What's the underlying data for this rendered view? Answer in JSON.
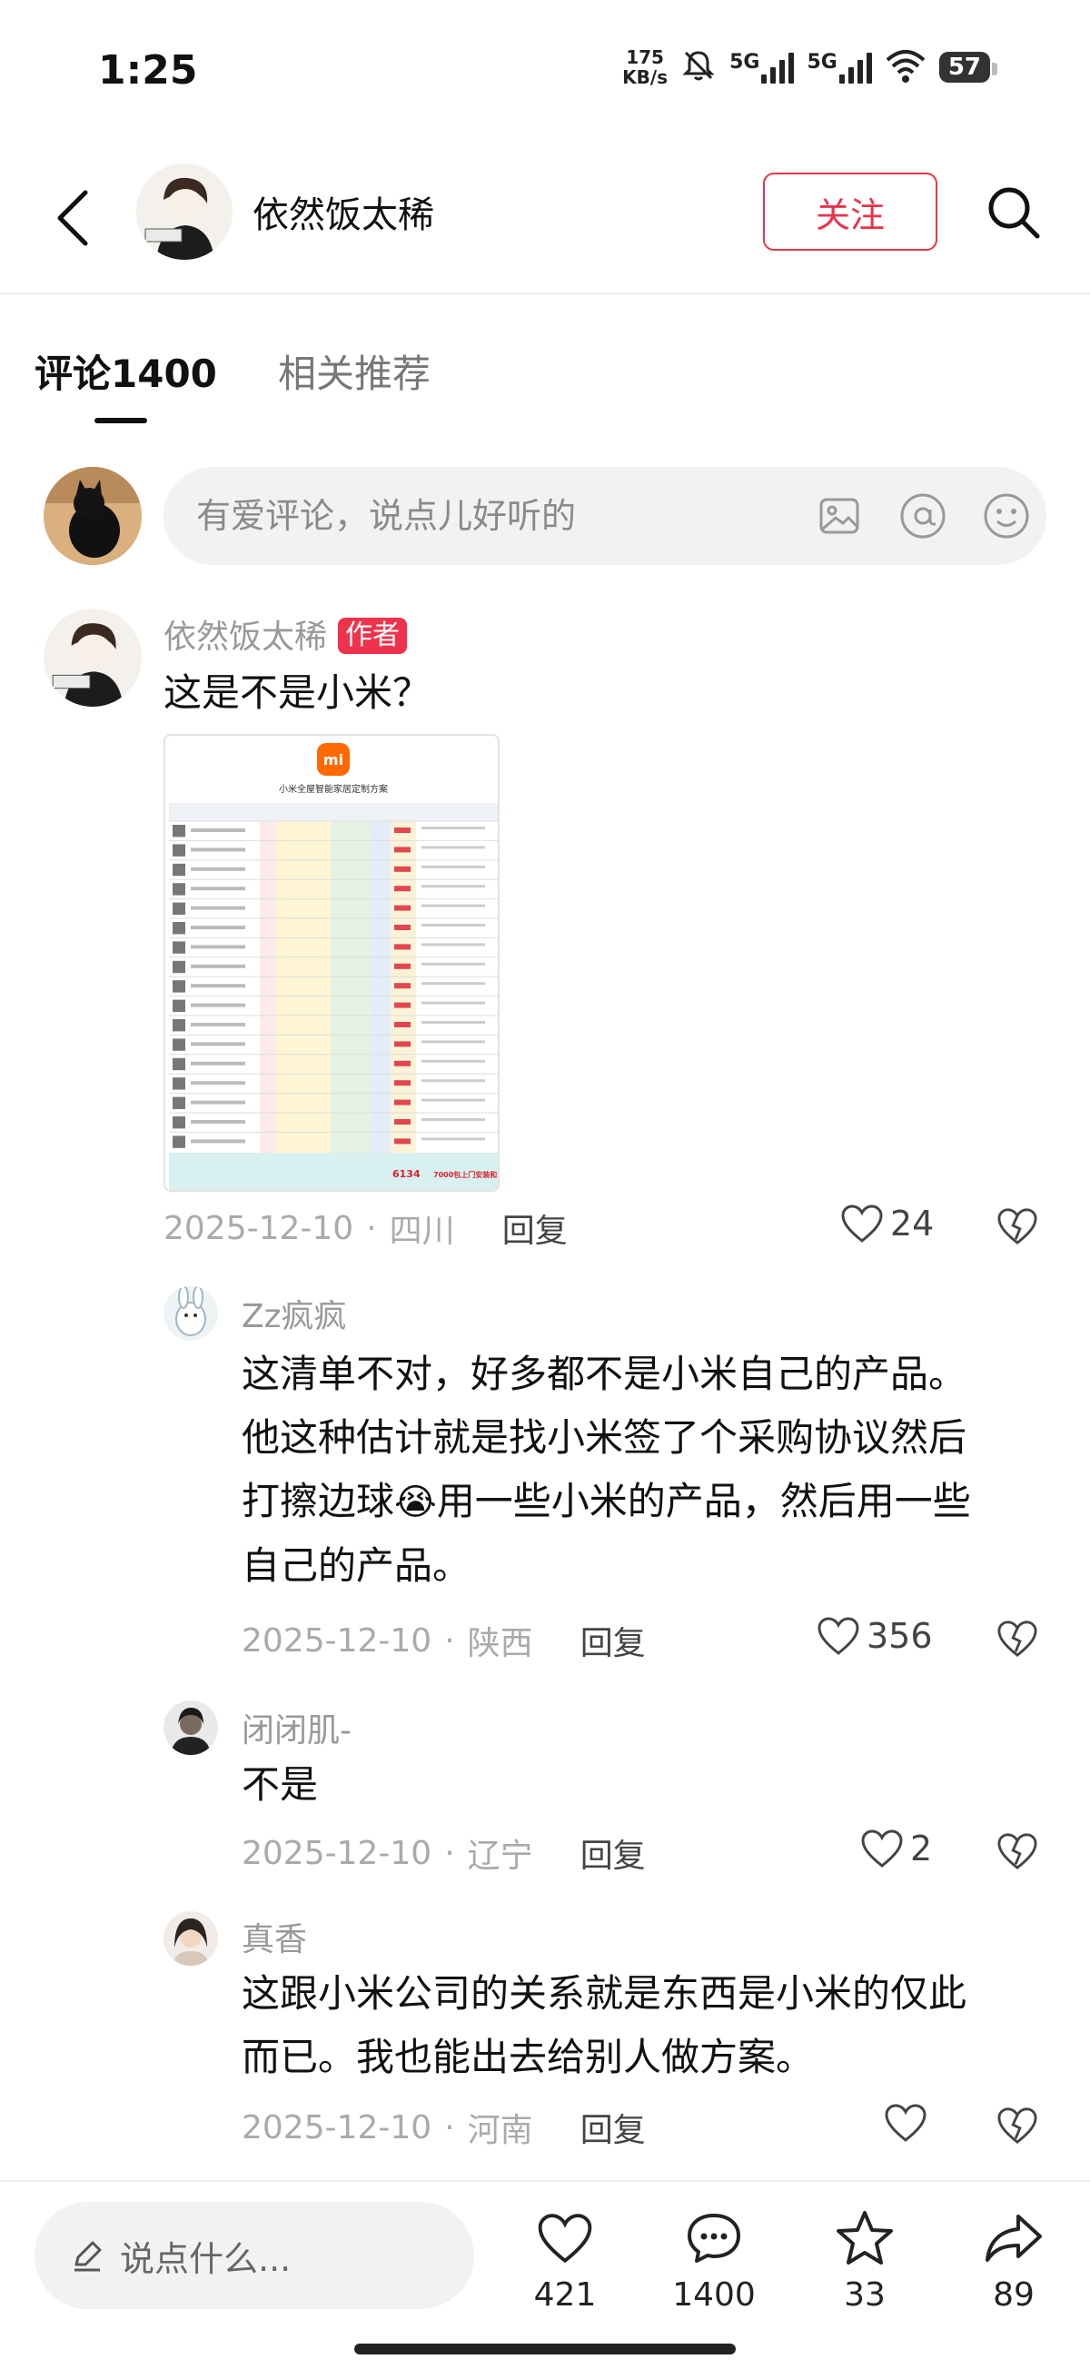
{
  "status_bar": {
    "time": "1:25",
    "net_speed_value": "175",
    "net_speed_unit": "KB/s",
    "signal1": "5G",
    "signal2": "5G",
    "battery": "57"
  },
  "header": {
    "user_name": "依然饭太稀",
    "follow_label": "关注"
  },
  "tabs": {
    "comments": "评论1400",
    "related": "相关推荐"
  },
  "comment_input": {
    "placeholder": "有爱评论，说点儿好听的"
  },
  "comments": [
    {
      "name": "依然饭太稀",
      "badge": "作者",
      "text": "这是不是小米？",
      "image": {
        "title": "小米全屋智能家居定制方案",
        "total": "6134",
        "footer": "7000包上门安装和"
      },
      "date": "2025-12-10",
      "region": "四川",
      "reply": "回复",
      "likes": "24"
    },
    {
      "name": "Zz疯疯",
      "text_lines": [
        "这清单不对，好多都不是小米自己的产品。",
        "他这种估计就是找小米签了个采购协议然后",
        "打擦边球",
        "用一些小米的产品，然后用一些",
        "自己的产品。"
      ],
      "emoji": "😭",
      "date": "2025-12-10",
      "region": "陕西",
      "reply": "回复",
      "likes": "356"
    },
    {
      "name": "闭闭肌-",
      "text": "不是",
      "date": "2025-12-10",
      "region": "辽宁",
      "reply": "回复",
      "likes": "2"
    },
    {
      "name": "真香",
      "text_lines": [
        "这跟小米公司的关系就是东西是小米的仅此",
        "而已。我也能出去给别人做方案。"
      ],
      "date": "2025-12-10",
      "region": "河南",
      "reply": "回复",
      "likes": ""
    }
  ],
  "bottom_bar": {
    "say_placeholder": "说点什么...",
    "likes": "421",
    "comments": "1400",
    "favorites": "33",
    "shares": "89"
  },
  "colors": {
    "accent": "#e8334a",
    "badge": "#f0334d",
    "muted_text": "#999999"
  }
}
